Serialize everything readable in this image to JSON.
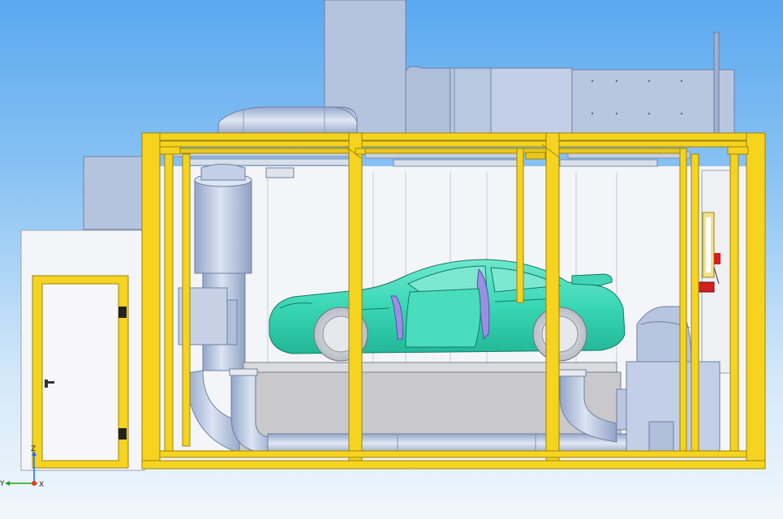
{
  "viewport": {
    "background_top": "#5aa8ef",
    "background_bottom": "#f1f7fc"
  },
  "colors": {
    "frame_yellow": "#f5d31f",
    "frame_edge": "#9a8410",
    "duct_blue": "#b4c4df",
    "duct_dark": "#8698bc",
    "car_teal": "#39d7b5",
    "wheel_grey": "#d6d9e0",
    "window_purple": "#9a8fe0",
    "wall_white": "#f4f5f8",
    "dyno_grey": "#c9c9cc",
    "axis_z": "#2a6cff",
    "axis_y": "#1aa51a",
    "axis_x": "#e03a1a"
  },
  "axis_triad": {
    "z_label": "Z",
    "y_label": "Y",
    "x_label": "X"
  },
  "icons": [
    "door-handle-icon",
    "axis-triad-icon"
  ]
}
